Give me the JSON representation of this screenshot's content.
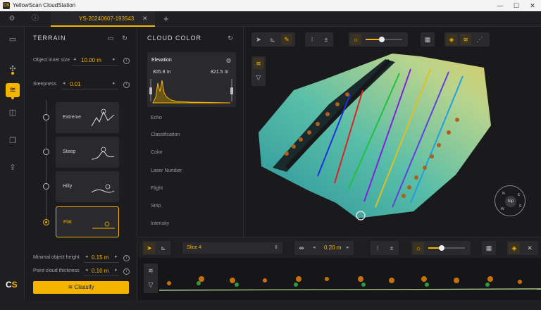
{
  "window": {
    "title": "YellowScan CloudStation",
    "minimize": "—",
    "maximize": "☐",
    "close": "✕"
  },
  "tabs": {
    "active_label": "YS-20240607-193543",
    "close": "✕",
    "add": "+"
  },
  "terrain": {
    "title": "TERRAIN",
    "object_inner_size": {
      "label": "Object inner size",
      "value": "10.00 m"
    },
    "steepness": {
      "label": "Steepness",
      "value": "0.01"
    },
    "presets": [
      {
        "label": "Extreme",
        "selected": false
      },
      {
        "label": "Steep",
        "selected": false
      },
      {
        "label": "Hilly",
        "selected": false
      },
      {
        "label": "Flat",
        "selected": true
      }
    ],
    "minimal_object_height": {
      "label": "Minimal object height",
      "value": "0.15 m"
    },
    "point_cloud_thickness": {
      "label": "Point cloud thickness",
      "value": "0.10 m"
    },
    "classify_label": "Classify"
  },
  "cloud_color": {
    "title": "CLOUD COLOR",
    "elevation": {
      "label": "Elevation",
      "min": "805.8 m",
      "max": "821.5 m"
    },
    "modes": [
      "Echo",
      "Classification",
      "Color",
      "Laser Number",
      "Flight",
      "Strip",
      "Intensity"
    ]
  },
  "viewport": {
    "compass_label": "top",
    "compass_letters": [
      "N",
      "E",
      "S",
      "W"
    ]
  },
  "slice": {
    "name": "Slice 4",
    "width": "0.20 m"
  },
  "colors": {
    "accent": "#f5b400",
    "panel": "#1c1c1e",
    "card": "#2a2a2e"
  }
}
